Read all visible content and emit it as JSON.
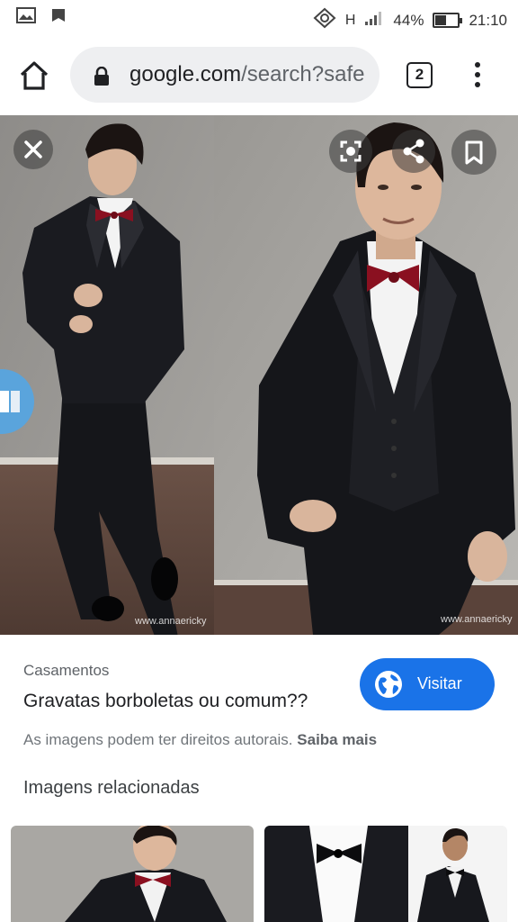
{
  "status_bar": {
    "network": "H",
    "battery_percent": "44%",
    "battery_level": 0.44,
    "time": "21:10"
  },
  "browser": {
    "url_domain": "google.com",
    "url_path": "/search?safe",
    "tab_count": "2"
  },
  "viewer": {
    "watermark_left": "www.annaericky",
    "watermark_right": "www.annaericky"
  },
  "result": {
    "source": "Casamentos",
    "title": "Gravatas borboletas ou comum??",
    "visit_label": "Visitar",
    "copyright_text": "As imagens podem ter direitos autorais.",
    "learn_more": "Saiba mais",
    "related_title": "Imagens relacionadas"
  },
  "icons": [
    "gallery-icon",
    "save-app-icon",
    "signal-icon",
    "home-icon",
    "lock-icon",
    "menu-icon",
    "close-icon",
    "lens-icon",
    "share-icon",
    "bookmark-icon",
    "globe-icon"
  ],
  "colors": {
    "accent": "#1a73e8",
    "omnibox": "#eeeff1",
    "suit": "#15161a",
    "bow_tie": "#8a1020",
    "wall": "#9a9894"
  }
}
